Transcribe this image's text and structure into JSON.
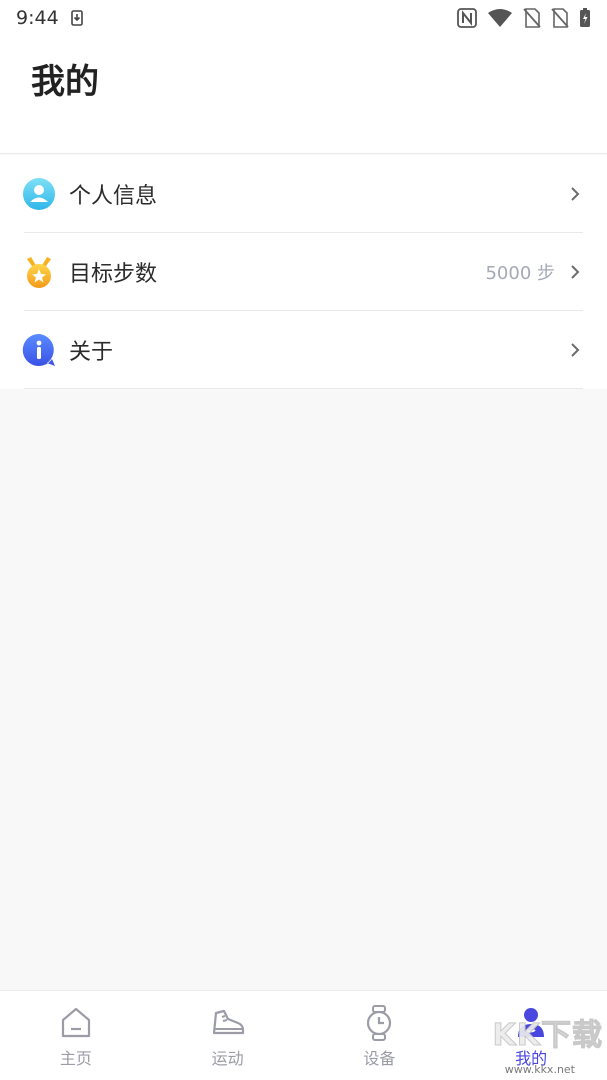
{
  "status_bar": {
    "time": "9:44",
    "icons": [
      "download-notification-icon",
      "nfc-icon",
      "wifi-icon",
      "no-sim-icon",
      "no-sim-2-icon",
      "battery-charging-icon"
    ]
  },
  "header": {
    "title": "我的"
  },
  "menu": {
    "items": [
      {
        "label": "个人信息",
        "icon": "user-profile-icon",
        "value": ""
      },
      {
        "label": "目标步数",
        "icon": "medal-icon",
        "value": "5000 步"
      },
      {
        "label": "关于",
        "icon": "info-icon",
        "value": ""
      }
    ],
    "chevron_icon": "chevron-right-icon"
  },
  "bottom_nav": {
    "items": [
      {
        "label": "主页",
        "icon": "home-icon",
        "active": false
      },
      {
        "label": "运动",
        "icon": "sneaker-icon",
        "active": false
      },
      {
        "label": "设备",
        "icon": "watch-icon",
        "active": false
      },
      {
        "label": "我的",
        "icon": "profile-icon",
        "active": true
      }
    ],
    "active_color": "#4a47e0",
    "inactive_color": "#9b9ca6"
  },
  "watermark": {
    "text": "KK下载",
    "url": "www.kkx.net"
  },
  "colors": {
    "background": "#f8f8f9",
    "accent": "#4a47e0",
    "value_text": "#a6a9b6"
  }
}
